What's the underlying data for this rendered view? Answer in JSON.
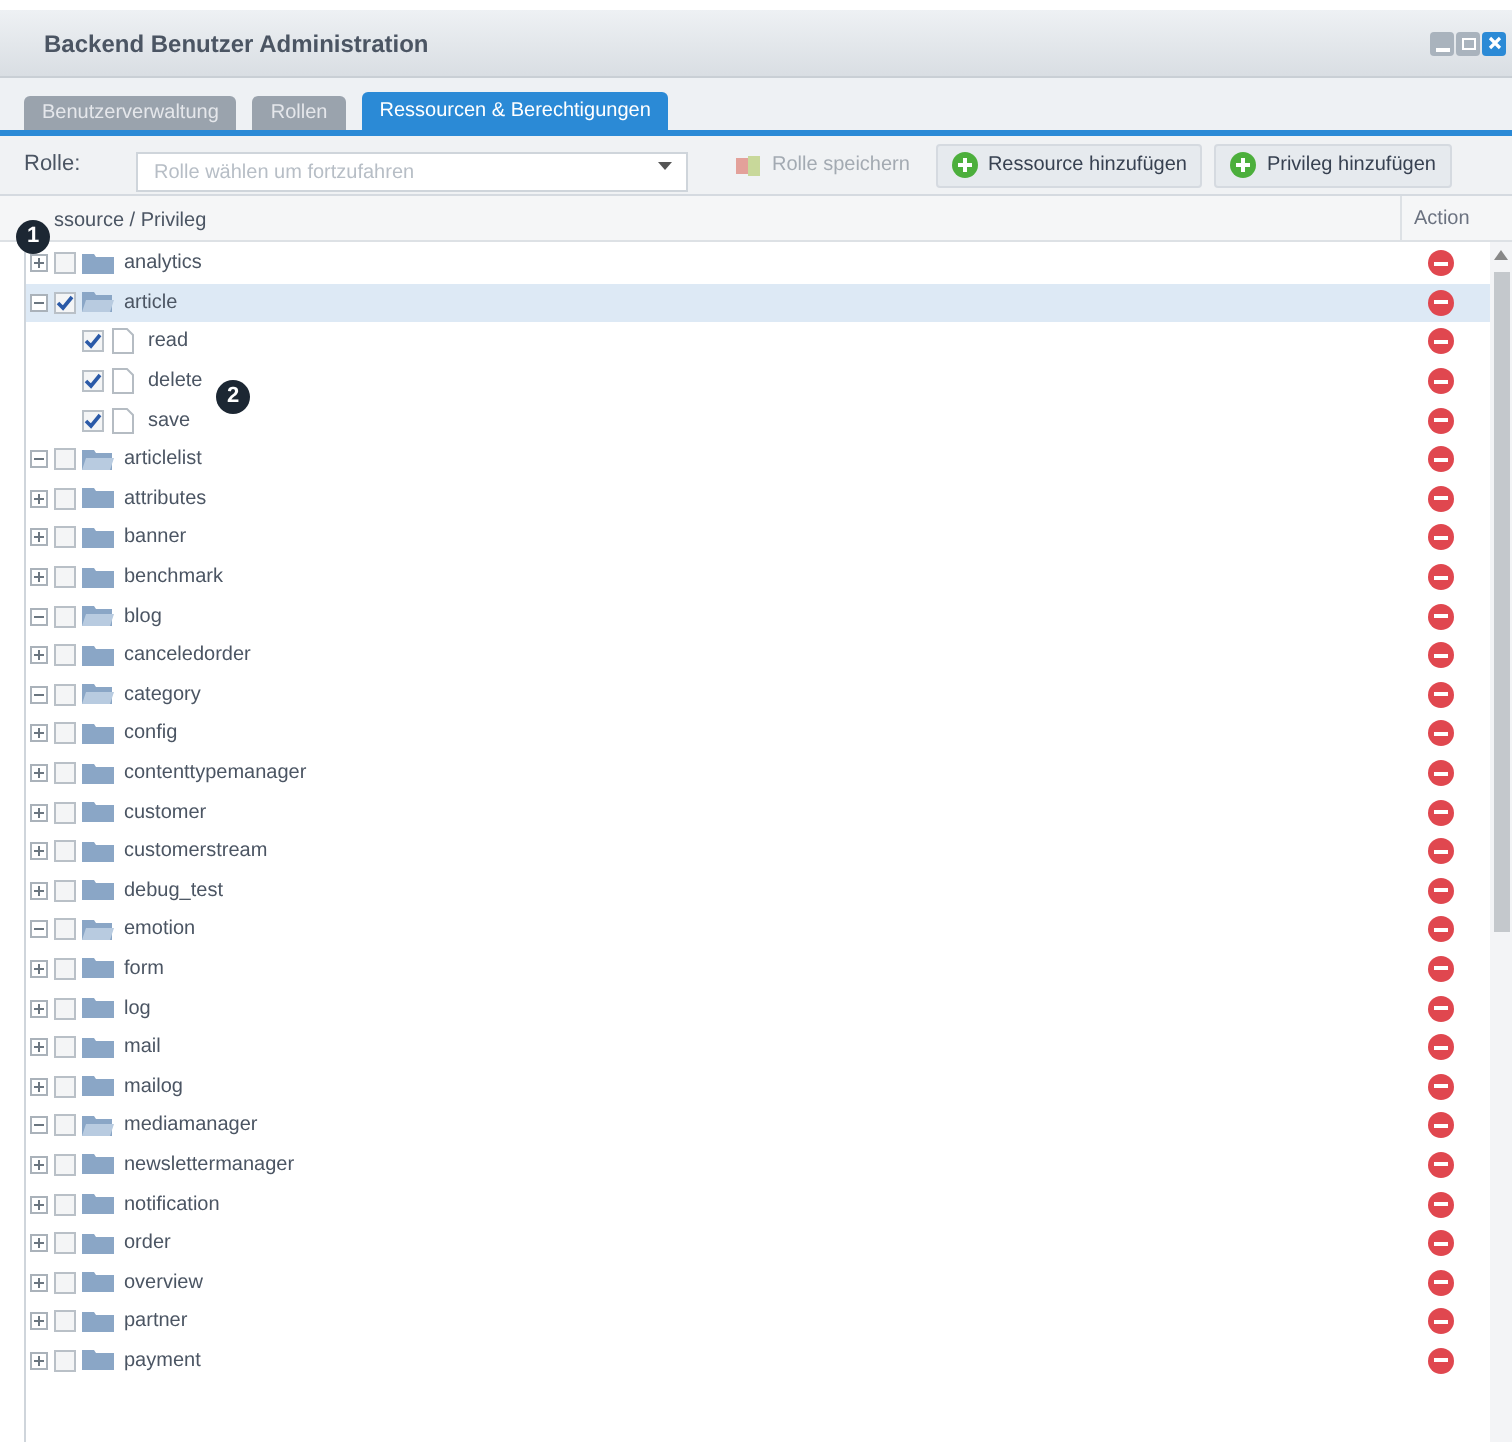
{
  "window": {
    "title": "Backend Benutzer Administration"
  },
  "tabs": [
    {
      "label": "Benutzerverwaltung",
      "selected": false
    },
    {
      "label": "Rollen",
      "selected": false
    },
    {
      "label": "Ressourcen & Berechtigungen",
      "selected": true
    }
  ],
  "toolbar": {
    "role_label": "Rolle:",
    "role_field": {
      "placeholder": "Rolle wählen um fortzufahren"
    },
    "buttons": [
      {
        "kind": "save",
        "label": "Rolle speichern",
        "disabled": true
      },
      {
        "kind": "add",
        "label": "Ressource hinzufügen",
        "disabled": false
      },
      {
        "kind": "add",
        "label": "Privileg hinzufügen",
        "disabled": false
      }
    ]
  },
  "tree": {
    "columns": [
      "ssource / Privileg",
      "Action"
    ],
    "rows": [
      {
        "label": "analytics",
        "expanded": false,
        "checked": false,
        "selected": false
      },
      {
        "label": "article",
        "expanded": true,
        "checked": true,
        "selected": true,
        "children": [
          {
            "label": "read",
            "checked": true
          },
          {
            "label": "delete",
            "checked": true
          },
          {
            "label": "save",
            "checked": true
          }
        ]
      },
      {
        "label": "articlelist",
        "expanded": true,
        "checked": false,
        "selected": false
      },
      {
        "label": "attributes",
        "expanded": false,
        "checked": false,
        "selected": false
      },
      {
        "label": "banner",
        "expanded": false,
        "checked": false,
        "selected": false
      },
      {
        "label": "benchmark",
        "expanded": false,
        "checked": false,
        "selected": false
      },
      {
        "label": "blog",
        "expanded": true,
        "checked": false,
        "selected": false
      },
      {
        "label": "canceledorder",
        "expanded": false,
        "checked": false,
        "selected": false
      },
      {
        "label": "category",
        "expanded": true,
        "checked": false,
        "selected": false
      },
      {
        "label": "config",
        "expanded": false,
        "checked": false,
        "selected": false
      },
      {
        "label": "contenttypemanager",
        "expanded": false,
        "checked": false,
        "selected": false
      },
      {
        "label": "customer",
        "expanded": false,
        "checked": false,
        "selected": false
      },
      {
        "label": "customerstream",
        "expanded": false,
        "checked": false,
        "selected": false
      },
      {
        "label": "debug_test",
        "expanded": false,
        "checked": false,
        "selected": false
      },
      {
        "label": "emotion",
        "expanded": true,
        "checked": false,
        "selected": false
      },
      {
        "label": "form",
        "expanded": false,
        "checked": false,
        "selected": false
      },
      {
        "label": "log",
        "expanded": false,
        "checked": false,
        "selected": false
      },
      {
        "label": "mail",
        "expanded": false,
        "checked": false,
        "selected": false
      },
      {
        "label": "mailog",
        "expanded": false,
        "checked": false,
        "selected": false
      },
      {
        "label": "mediamanager",
        "expanded": true,
        "checked": false,
        "selected": false
      },
      {
        "label": "newslettermanager",
        "expanded": false,
        "checked": false,
        "selected": false
      },
      {
        "label": "notification",
        "expanded": false,
        "checked": false,
        "selected": false
      },
      {
        "label": "order",
        "expanded": false,
        "checked": false,
        "selected": false
      },
      {
        "label": "overview",
        "expanded": false,
        "checked": false,
        "selected": false
      },
      {
        "label": "partner",
        "expanded": false,
        "checked": false,
        "selected": false
      },
      {
        "label": "payment",
        "expanded": false,
        "checked": false,
        "selected": false
      }
    ]
  },
  "callouts": [
    "1",
    "2"
  ]
}
